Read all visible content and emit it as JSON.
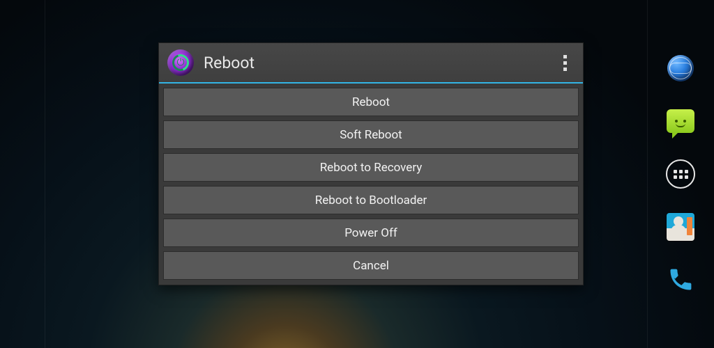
{
  "dialog": {
    "title": "Reboot",
    "options": [
      {
        "label": "Reboot"
      },
      {
        "label": "Soft Reboot"
      },
      {
        "label": "Reboot to Recovery"
      },
      {
        "label": "Reboot to Bootloader"
      },
      {
        "label": "Power Off"
      },
      {
        "label": "Cancel"
      }
    ]
  },
  "dock": {
    "items": [
      {
        "name": "browser"
      },
      {
        "name": "messaging"
      },
      {
        "name": "app-drawer"
      },
      {
        "name": "contacts"
      },
      {
        "name": "phone"
      }
    ]
  }
}
